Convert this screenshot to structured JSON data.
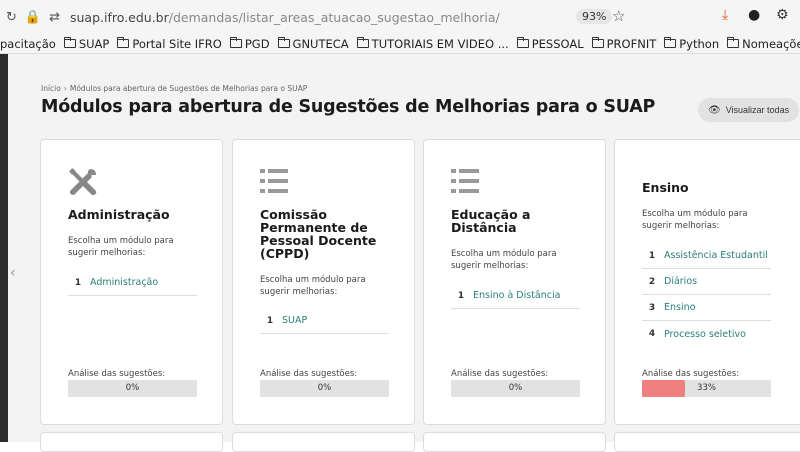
{
  "browser": {
    "url_host": "suap.ifro.edu.br",
    "url_path": "/demandas/listar_areas_atuacao_sugestao_melhoria/",
    "zoom": "93%",
    "bookmarks": [
      "pacitação",
      "SUAP",
      "Portal Site IFRO",
      "PGD",
      "GNUTECA",
      "TUTORIAIS EM VIDEO ...",
      "PESSOAL",
      "PROFNIT",
      "Python",
      "Nomeações"
    ]
  },
  "breadcrumb": [
    "Início",
    "Módulos para abertura de Sugestões de Melhorias para o SUAP"
  ],
  "page_title": "Módulos para abertura de Sugestões de Melhorias para o SUAP",
  "view_all_label": "Visualizar todas",
  "analysis_label": "Análise das sugestões:",
  "cards": [
    {
      "icon": "tools-icon",
      "title": "Administração",
      "description": "Escolha um módulo para sugerir melhorias:",
      "modules": [
        {
          "num": "1",
          "label": "Administração"
        }
      ],
      "progress_text": "0%",
      "progress": 0
    },
    {
      "icon": "list-icon",
      "title": "Comissão Permanente de Pessoal Docente (CPPD)",
      "description": "Escolha um módulo para sugerir melhorias:",
      "modules": [
        {
          "num": "1",
          "label": "SUAP"
        }
      ],
      "progress_text": "0%",
      "progress": 0
    },
    {
      "icon": "list-icon",
      "title": "Educação a Distância",
      "description": "Escolha um módulo para sugerir melhorias:",
      "modules": [
        {
          "num": "1",
          "label": "Ensino à Distância"
        }
      ],
      "progress_text": "0%",
      "progress": 0
    },
    {
      "icon": "",
      "title": "Ensino",
      "description": "Escolha um módulo para sugerir melhorias:",
      "modules": [
        {
          "num": "1",
          "label": "Assistência Estudantil"
        },
        {
          "num": "2",
          "label": "Diários"
        },
        {
          "num": "3",
          "label": "Ensino"
        },
        {
          "num": "4",
          "label": "Processo seletivo"
        }
      ],
      "progress_text": "33%",
      "progress": 0.33
    }
  ],
  "colors": {
    "link": "#2b7e79",
    "progress_fill": "#f08080"
  }
}
